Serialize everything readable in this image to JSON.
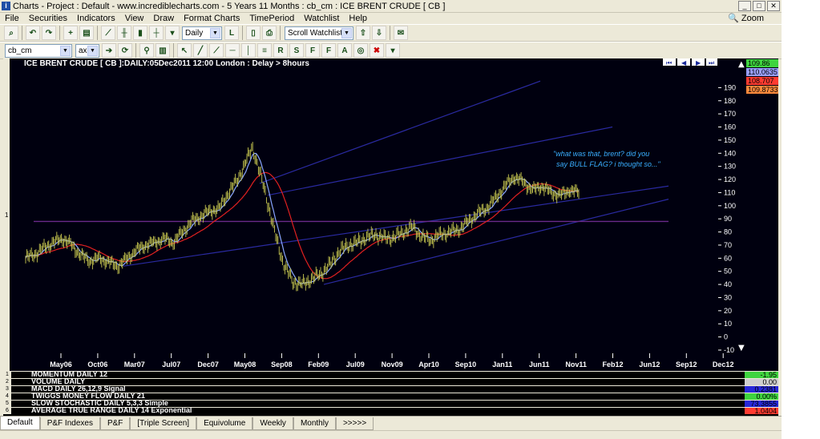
{
  "window": {
    "title": "Charts - Project : Default - www.incrediblecharts.com - 5 Years 11 Months : cb_cm : ICE BRENT CRUDE  [ CB ]",
    "zoom_label": "Zoom"
  },
  "menu": [
    "File",
    "Securities",
    "Indicators",
    "View",
    "Draw",
    "Format Charts",
    "TimePeriod",
    "Watchlist",
    "Help"
  ],
  "toolbar1": {
    "period_select": "Daily",
    "watchlist_select": "Scroll Watchlist"
  },
  "toolbar2": {
    "security_select": "cb_cm",
    "ax_select": "ax"
  },
  "chart": {
    "header": "ICE BRENT CRUDE  [ CB ]:DAILY:05Dec2011 12:00 London  : Delay > 8hours",
    "annotation_line1": "\"what was that, brent? did you",
    "annotation_line2": "say BULL FLAG? i thought so...\"",
    "left_marker": "1",
    "price_labels": [
      {
        "text": "109.86",
        "bg": "#3fd43f"
      },
      {
        "text": "110.0635",
        "bg": "#9aa0ff"
      },
      {
        "text": "108.707",
        "bg": "#ff3b30"
      },
      {
        "text": "109.8733",
        "bg": "#ff8a3d"
      }
    ],
    "colors": {
      "background": "#000010",
      "price": "#c8c850",
      "ma_fast": "#8aa6ff",
      "ma_slow": "#e02020",
      "channel": "#2a2aa0",
      "hline": "#6a2a8a",
      "axis_text": "#ffffff",
      "annotation": "#3ab0ff"
    }
  },
  "chart_data": {
    "type": "line",
    "title": "ICE BRENT CRUDE  [ CB ]:DAILY:05Dec2011 12:00 London  : Delay > 8hours",
    "xlabel": "",
    "ylabel": "",
    "ylim": [
      -10,
      200
    ],
    "y_ticks": [
      -10,
      0,
      10,
      20,
      30,
      40,
      50,
      60,
      70,
      80,
      90,
      100,
      110,
      120,
      130,
      140,
      150,
      160,
      170,
      180,
      190
    ],
    "x_tick_labels": [
      "May06",
      "Oct06",
      "Mar07",
      "Jul07",
      "Dec07",
      "May08",
      "Sep08",
      "Feb09",
      "Jul09",
      "Nov09",
      "Apr10",
      "Sep10",
      "Jan11",
      "Jun11",
      "Nov11",
      "Feb12",
      "Jun12",
      "Sep12",
      "Dec12"
    ],
    "grid": false,
    "legend": "none",
    "series": [
      {
        "values_by_time": [
          [
            0,
            60
          ],
          [
            0.5,
            63
          ],
          [
            1,
            68
          ],
          [
            1.5,
            72
          ],
          [
            2,
            75
          ],
          [
            2.5,
            70
          ],
          [
            3,
            62
          ],
          [
            3.5,
            58
          ],
          [
            4,
            60
          ],
          [
            4.5,
            57
          ],
          [
            5,
            54
          ],
          [
            5.5,
            60
          ],
          [
            6,
            66
          ],
          [
            6.5,
            70
          ],
          [
            7,
            72
          ],
          [
            7.5,
            75
          ],
          [
            8,
            72
          ],
          [
            8.5,
            80
          ],
          [
            9,
            88
          ],
          [
            9.5,
            92
          ],
          [
            10,
            96
          ],
          [
            10.5,
            98
          ],
          [
            11,
            110
          ],
          [
            11.5,
            120
          ],
          [
            12,
            135
          ],
          [
            12.3,
            145
          ],
          [
            12.6,
            130
          ],
          [
            13,
            110
          ],
          [
            13.5,
            80
          ],
          [
            14,
            55
          ],
          [
            14.5,
            42
          ],
          [
            15,
            40
          ],
          [
            15.5,
            44
          ],
          [
            16,
            48
          ],
          [
            16.5,
            55
          ],
          [
            17,
            65
          ],
          [
            17.5,
            70
          ],
          [
            18,
            72
          ],
          [
            18.5,
            76
          ],
          [
            19,
            78
          ],
          [
            19.5,
            75
          ],
          [
            20,
            76
          ],
          [
            20.5,
            80
          ],
          [
            21,
            84
          ],
          [
            21.5,
            76
          ],
          [
            22,
            74
          ],
          [
            22.5,
            78
          ],
          [
            23,
            80
          ],
          [
            23.5,
            82
          ],
          [
            24,
            88
          ],
          [
            24.5,
            94
          ],
          [
            25,
            98
          ],
          [
            25.5,
            106
          ],
          [
            26,
            115
          ],
          [
            26.5,
            122
          ],
          [
            27,
            118
          ],
          [
            27.5,
            112
          ],
          [
            28,
            115
          ],
          [
            28.5,
            110
          ],
          [
            29,
            108
          ],
          [
            29.5,
            112
          ],
          [
            30,
            110
          ]
        ]
      }
    ],
    "horizontal_line": 88,
    "annotation": "\"what was that, brent? did you say BULL FLAG? i thought so...\""
  },
  "indicators": [
    {
      "num": "1",
      "label": "MOMENTUM DAILY 12",
      "value": "-1.95",
      "bg": "#3fd43f"
    },
    {
      "num": "2",
      "label": "VOLUME DAILY",
      "value": "0.00",
      "bg": "#cfcfcf"
    },
    {
      "num": "3",
      "label": "MACD DAILY 26,12,9 Signal",
      "value": "0.2381",
      "bg": "#2828d8"
    },
    {
      "num": "4",
      "label": "TWIGGS MONEY FLOW DAILY 21",
      "value": "0.00%",
      "bg": "#3fd43f"
    },
    {
      "num": "5",
      "label": "SLOW STOCHASTIC DAILY 5,3,3 Simple",
      "value": "73.3855",
      "bg": "#2828d8"
    },
    {
      "num": "6",
      "label": "AVERAGE TRUE RANGE DAILY 14 Exponential",
      "value": "1.0404",
      "bg": "#ff3b30"
    }
  ],
  "tabs": [
    "Default",
    "P&F Indexes",
    "P&F",
    "[Triple Screen]",
    "Equivolume",
    "Weekly",
    "Monthly",
    ">>>>>"
  ]
}
